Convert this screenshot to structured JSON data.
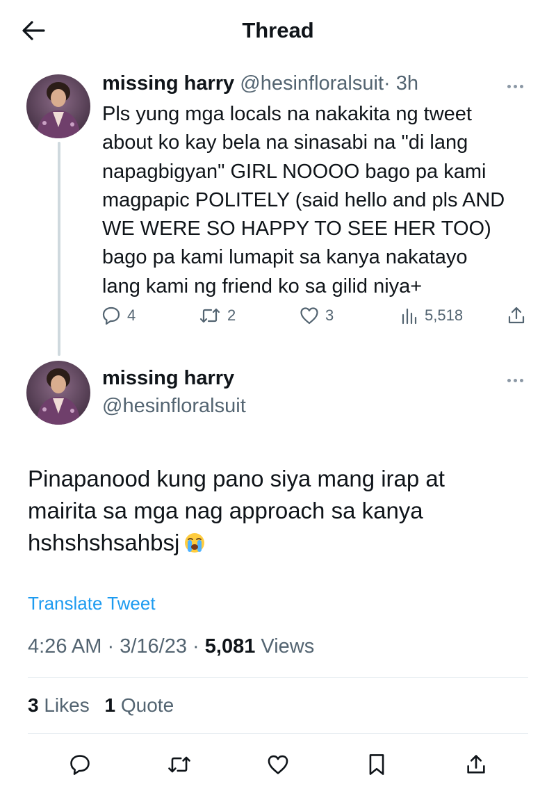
{
  "header": {
    "title": "Thread"
  },
  "tweet1": {
    "name": "missing harry",
    "handle": "@hesinfloralsuit",
    "time": "· 3h",
    "lines": [
      "Pls yung mga locals na nakakita ng tweet",
      "about ko kay bela na sinasabi na \"di lang",
      "napagbigyan\" GIRL NOOOO bago pa kami",
      "magpapic POLITELY (said hello and pls AND",
      "WE WERE SO HAPPY TO SEE HER TOO)",
      "bago pa kami lumapit sa kanya nakatayo",
      "lang kami ng friend ko sa gilid niya+"
    ],
    "replies": "4",
    "retweets": "2",
    "likes": "3",
    "views": "5,518"
  },
  "tweet2": {
    "name": "missing harry",
    "handle": "@hesinfloralsuit",
    "lines": [
      "Pinapanood kung pano siya mang irap at",
      "mairita sa mga nag approach sa kanya",
      "hshshshsahbsj"
    ],
    "translate_label": "Translate Tweet",
    "time": "4:26 AM",
    "date": "3/16/23",
    "views_count": "5,081",
    "views_label": "Views",
    "likes_count": "3",
    "likes_label": "Likes",
    "quotes_count": "1",
    "quotes_label": "Quote"
  },
  "icons": {
    "back": "arrow-left-icon",
    "more": "more-dots-icon",
    "reply": "comment-icon",
    "retweet": "retweet-icon",
    "like": "heart-icon",
    "views": "analytics-icon",
    "share": "share-icon",
    "bookmark": "bookmark-icon",
    "emoji": "loudly-crying-face-emoji"
  },
  "colors": {
    "link": "#1d9bf0",
    "muted": "#536471",
    "text": "#0f1419"
  }
}
